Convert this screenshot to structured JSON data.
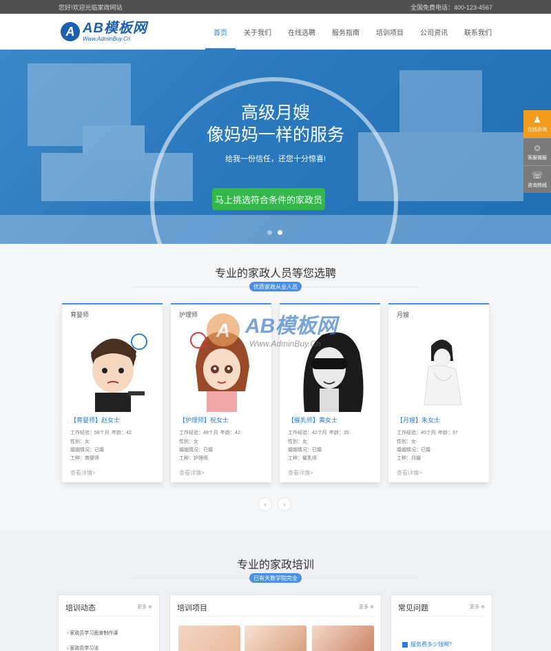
{
  "topbar": {
    "welcome": "您好!欢迎光临家政网站",
    "hotline": "全国免费电话：400-123-4567"
  },
  "logo": {
    "mark": "A",
    "title": "AB模板网",
    "subtitle": "Www.AdminBuy.Cn"
  },
  "nav": {
    "items": [
      "首页",
      "关于我们",
      "在线选聘",
      "服务指南",
      "培训项目",
      "公司资讯",
      "联系我们"
    ]
  },
  "hero": {
    "title_line1": "高级月嫂",
    "title_line2": "像妈妈一样的服务",
    "subtitle": "给我一份信任，还您十分惊喜!",
    "cta": "马上挑选符合条件的家政员"
  },
  "float_bar": {
    "qq": "在线咨询",
    "service": "客服微服",
    "phone": "咨询热线"
  },
  "section1": {
    "title": "专业的家政人员等您选聘",
    "badge": "优质家政从业人员"
  },
  "cards": [
    {
      "category": "育婴师",
      "name": "【育婴师】赵女士",
      "experience": "工作经验：58个月",
      "age": "年龄：42",
      "gender": "性别：女",
      "marital": "婚姻情况：已婚",
      "job": "工种：育婴师",
      "more": "查看详情>"
    },
    {
      "category": "护理师",
      "name": "【护理师】祝女士",
      "experience": "工作经验：48个月",
      "age": "年龄：42",
      "gender": "性别：女",
      "marital": "婚姻情况：已婚",
      "job": "工种：护理师",
      "more": "查看详情>"
    },
    {
      "category": "",
      "name": "【催乳师】黄女士",
      "experience": "工作经验：42个月",
      "age": "年龄：39",
      "gender": "性别：女",
      "marital": "婚姻情况：已婚",
      "job": "工种：催乳师",
      "more": "查看详情>"
    },
    {
      "category": "月嫂",
      "name": "【月嫂】朱女士",
      "experience": "工作经验：40个月",
      "age": "年龄：37",
      "gender": "性别：女",
      "marital": "婚姻情况：已婚",
      "job": "工种：月嫂",
      "more": "查看详情>"
    }
  ],
  "carousel_arrows": {
    "prev": "‹",
    "next": "›"
  },
  "section2": {
    "title": "专业的家政培训",
    "badge": "已有天数学院完全"
  },
  "panels": {
    "news": {
      "title": "培训动态",
      "more": "更多",
      "items": [
        "家政员学习面食制作课",
        "家政员学习法"
      ]
    },
    "projects": {
      "title": "培训项目",
      "more": "更多"
    },
    "faq": {
      "title": "常见问题",
      "more": "更多",
      "items": [
        "服务费多少钱啊？"
      ]
    }
  },
  "watermark": {
    "brand": "AB模板网",
    "url": "Www.AdminBuy.Cn"
  },
  "colors": {
    "brand_blue": "#1f5fb0",
    "accent": "#2b7fd0",
    "hero": "#2a78bd",
    "cta_green": "#33b849",
    "float_orange": "#f29b1c"
  }
}
